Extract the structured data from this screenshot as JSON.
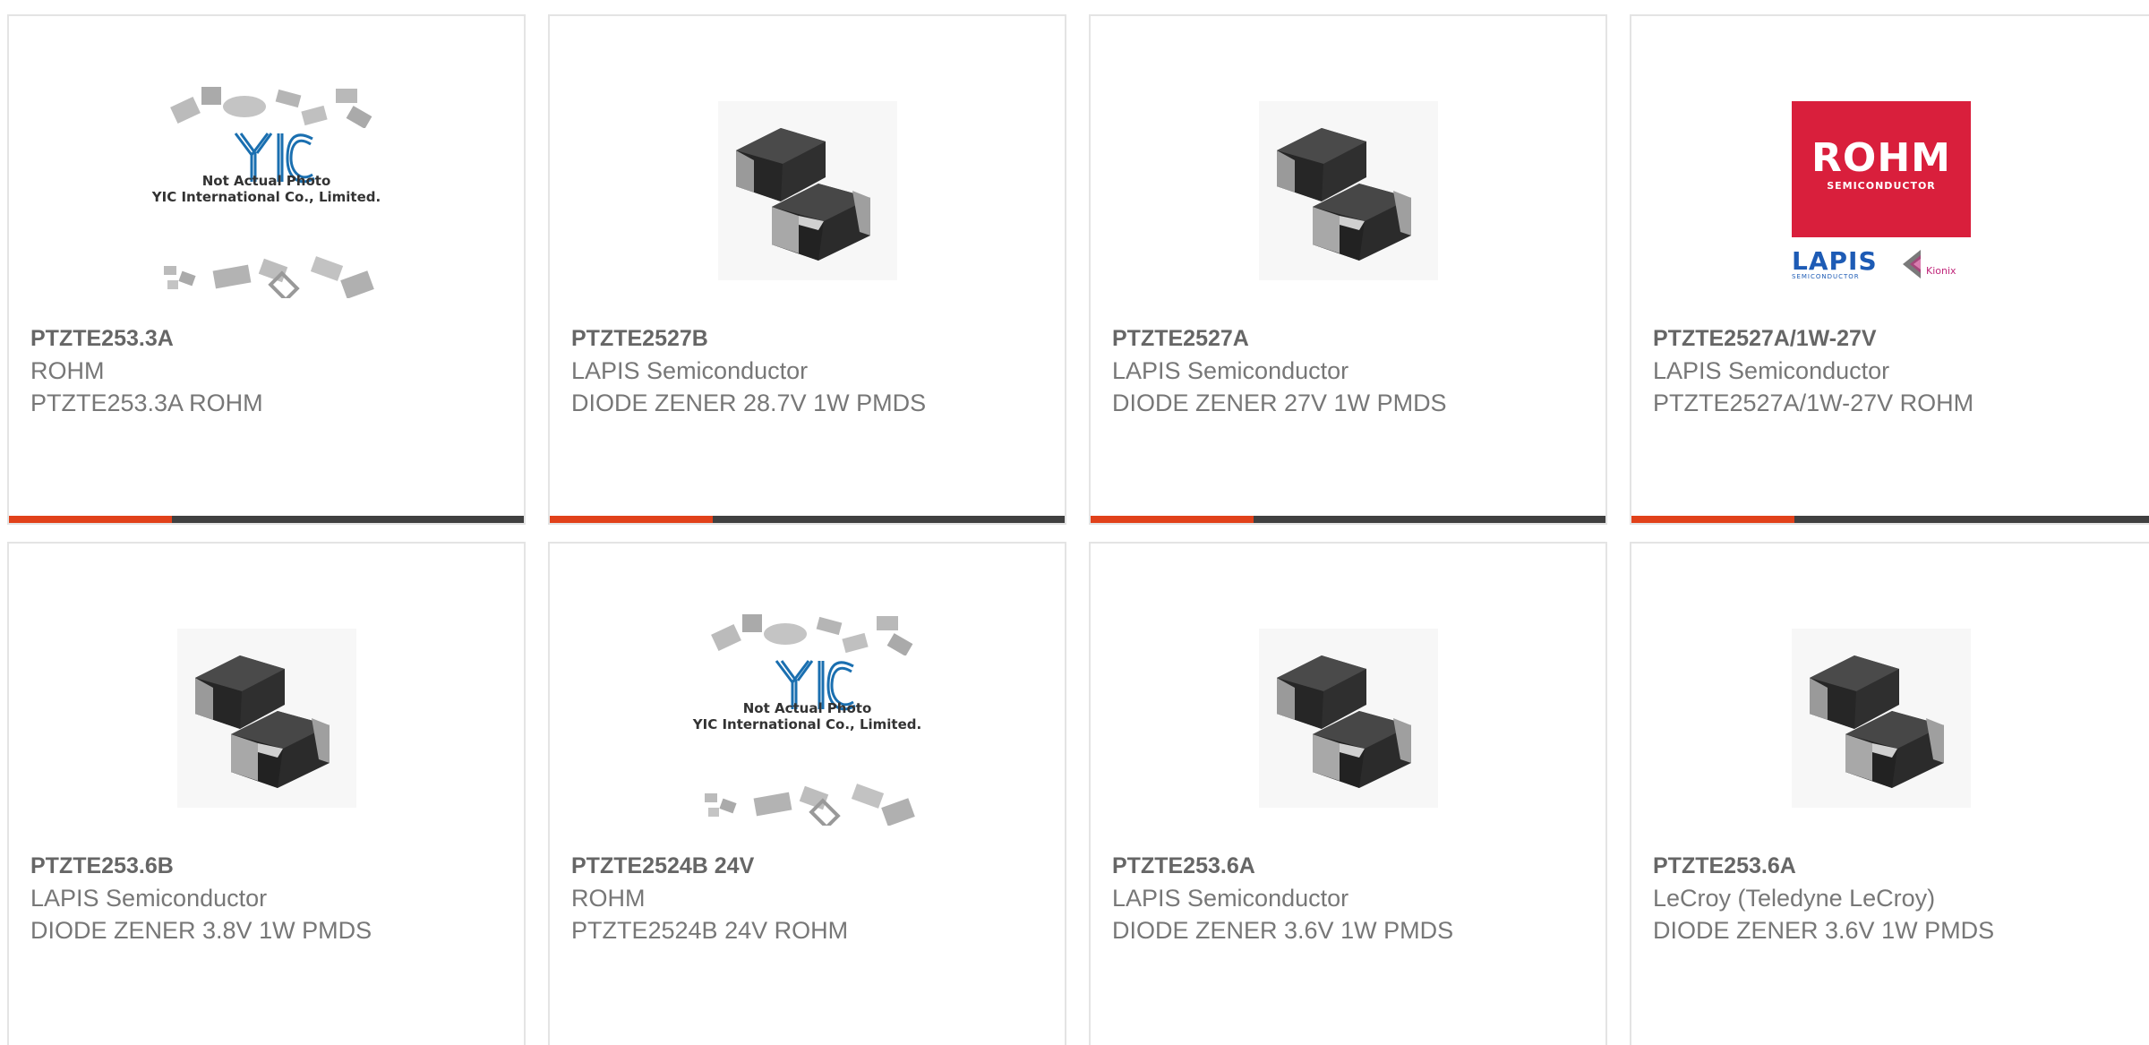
{
  "products": [
    {
      "part_number": "PTZTE253.3A",
      "manufacturer": "ROHM",
      "description": "PTZTE253.3A ROHM",
      "image": "placeholder-photo"
    },
    {
      "part_number": "PTZTE2527B",
      "manufacturer": "LAPIS Semiconductor",
      "description": "DIODE ZENER 28.7V 1W PMDS",
      "image": "smd-diode"
    },
    {
      "part_number": "PTZTE2527A",
      "manufacturer": "LAPIS Semiconductor",
      "description": "DIODE ZENER 27V 1W PMDS",
      "image": "smd-diode"
    },
    {
      "part_number": "PTZTE2527A/1W-27V",
      "manufacturer": "LAPIS Semiconductor",
      "description": "PTZTE2527A/1W-27V ROHM",
      "image": "rohm-logo"
    },
    {
      "part_number": "PTZTE253.6B",
      "manufacturer": "LAPIS Semiconductor",
      "description": "DIODE ZENER 3.8V 1W PMDS",
      "image": "smd-diode"
    },
    {
      "part_number": "PTZTE2524B 24V",
      "manufacturer": "ROHM",
      "description": "PTZTE2524B 24V ROHM",
      "image": "placeholder-photo"
    },
    {
      "part_number": "PTZTE253.6A",
      "manufacturer": "LAPIS Semiconductor",
      "description": "DIODE ZENER 3.6V 1W PMDS",
      "image": "smd-diode"
    },
    {
      "part_number": "PTZTE253.6A",
      "manufacturer": "LeCroy (Teledyne LeCroy)",
      "description": "DIODE ZENER 3.6V 1W PMDS",
      "image": "smd-diode"
    }
  ],
  "placeholder": {
    "brand": "YIC",
    "line1": "Not Actual Photo",
    "line2": "YIC International Co., Limited."
  },
  "rohm_logo": {
    "brand": "ROHM",
    "tagline": "SEMICONDUCTOR",
    "sub_brand": "LAPIS",
    "sub_tagline": "SEMICONDUCTOR",
    "partner": "Kionix"
  },
  "colors": {
    "accent": "#e1411a",
    "bar": "#404040",
    "border": "#e4e4e4",
    "rohm_red": "#d91f3c",
    "lapis_blue": "#1d5bb5",
    "yic_blue": "#1a6fb0"
  }
}
